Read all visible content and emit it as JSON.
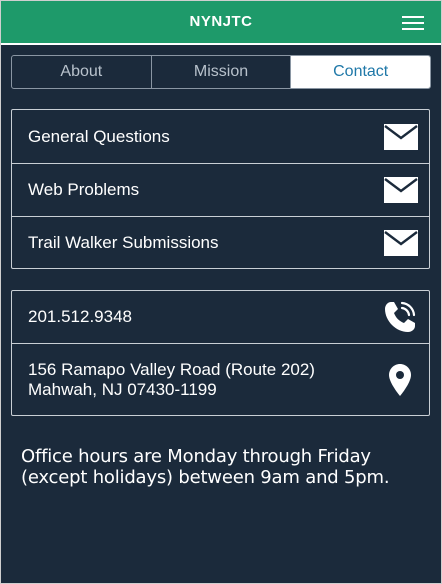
{
  "header": {
    "title": "NYNJTC",
    "menu_icon": "hamburger-menu-icon"
  },
  "tabs": [
    {
      "label": "About",
      "active": false
    },
    {
      "label": "Mission",
      "active": false
    },
    {
      "label": "Contact",
      "active": true
    }
  ],
  "email_list": [
    {
      "label": "General Questions",
      "icon": "envelope-icon"
    },
    {
      "label": "Web Problems",
      "icon": "envelope-icon"
    },
    {
      "label": "Trail Walker Submissions",
      "icon": "envelope-icon"
    }
  ],
  "contact": {
    "phone": "201.512.9348",
    "phone_icon": "phone-icon",
    "address_line1": "156 Ramapo Valley Road (Route 202)",
    "address_line2": "Mahwah, NJ 07430-1199",
    "address_icon": "map-pin-icon"
  },
  "office_hours": "Office hours are Monday through Friday (except holidays) between 9am and 5pm.",
  "colors": {
    "header_bg": "#1e9a6a",
    "page_bg": "#1b2a3b",
    "active_tab_text": "#1f78a8"
  }
}
